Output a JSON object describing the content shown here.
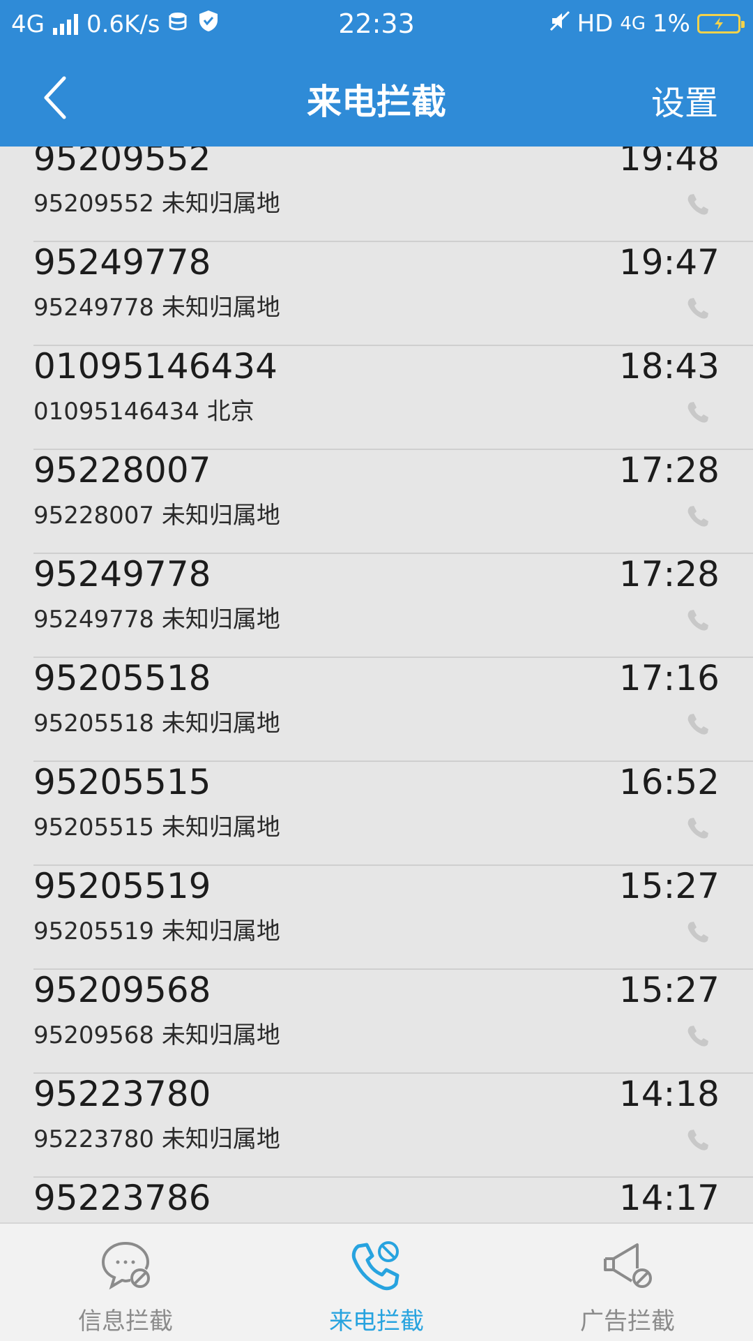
{
  "status_bar": {
    "network": "4G",
    "speed": "0.6K/s",
    "time": "22:33",
    "hd": "HD",
    "network2": "4G",
    "battery": "1%"
  },
  "header": {
    "title": "来电拦截",
    "settings_label": "设置"
  },
  "calls": [
    {
      "number": "95209552",
      "detail": "95209552 未知归属地",
      "time": "19:48"
    },
    {
      "number": "95249778",
      "detail": "95249778 未知归属地",
      "time": "19:47"
    },
    {
      "number": "01095146434",
      "detail": "01095146434 北京",
      "time": "18:43"
    },
    {
      "number": "95228007",
      "detail": "95228007 未知归属地",
      "time": "17:28"
    },
    {
      "number": "95249778",
      "detail": "95249778 未知归属地",
      "time": "17:28"
    },
    {
      "number": "95205518",
      "detail": "95205518 未知归属地",
      "time": "17:16"
    },
    {
      "number": "95205515",
      "detail": "95205515 未知归属地",
      "time": "16:52"
    },
    {
      "number": "95205519",
      "detail": "95205519 未知归属地",
      "time": "15:27"
    },
    {
      "number": "95209568",
      "detail": "95209568 未知归属地",
      "time": "15:27"
    },
    {
      "number": "95223780",
      "detail": "95223780 未知归属地",
      "time": "14:18"
    },
    {
      "number": "95223786",
      "detail": "",
      "time": "14:17"
    }
  ],
  "bottom_nav": {
    "tabs": [
      {
        "label": "信息拦截",
        "icon": "message-block-icon"
      },
      {
        "label": "来电拦截",
        "icon": "call-block-icon"
      },
      {
        "label": "广告拦截",
        "icon": "ad-block-icon"
      }
    ],
    "active_index": 1
  },
  "colors": {
    "primary": "#2f8bd7",
    "active_tab": "#27a3df",
    "inactive_tab": "#8b8b8b",
    "list_bg": "#e6e6e6"
  }
}
